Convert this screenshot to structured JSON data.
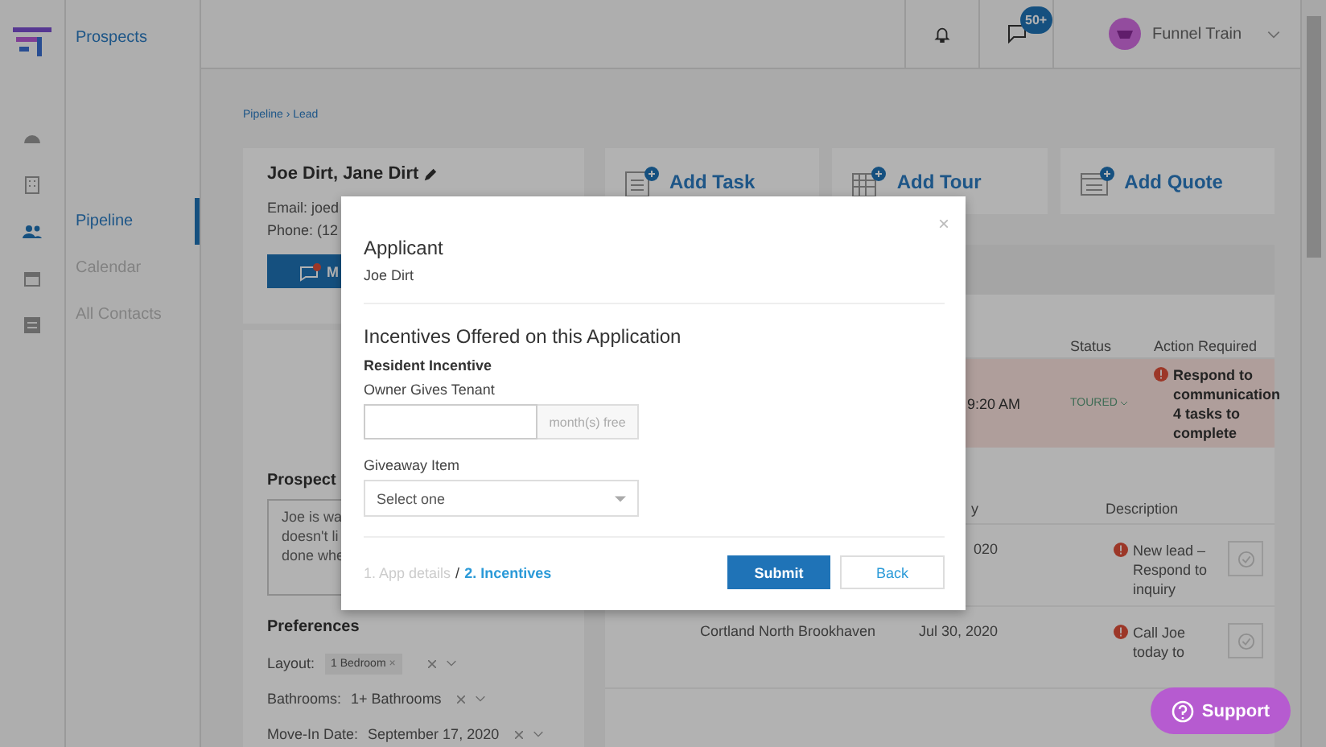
{
  "app": {
    "title": "Prospects"
  },
  "rail": [
    {
      "kind": "gauge",
      "selected": false
    },
    {
      "kind": "building",
      "selected": false
    },
    {
      "kind": "people",
      "selected": true
    },
    {
      "kind": "calendar",
      "selected": false
    },
    {
      "kind": "list",
      "selected": false
    }
  ],
  "nav": [
    {
      "label": "Pipeline",
      "selected": true
    },
    {
      "label": "Calendar",
      "selected": false
    },
    {
      "label": "All Contacts",
      "selected": false
    }
  ],
  "topbar": {
    "messages_badge": "50+",
    "user": "Funnel Train"
  },
  "breadcrumb": "Pipeline › Lead",
  "lead": {
    "name": "Joe Dirt, Jane Dirt",
    "email": "Email: joed",
    "phone": "Phone: (12",
    "message_button": "M",
    "notes_title": "Prospect",
    "notes_lines": [
      "Joe is wa",
      "doesn't li",
      "done whe"
    ]
  },
  "preferences": {
    "title": "Preferences",
    "items": [
      {
        "label": "Layout:",
        "value": "1 Bedroom",
        "kind": "tag",
        "remove": "×"
      },
      {
        "label": "Bathrooms:",
        "value": "1+ Bathrooms",
        "kind": "text"
      },
      {
        "label": "Move-In Date:",
        "value": "September 17, 2020",
        "kind": "text"
      }
    ]
  },
  "actions": [
    {
      "kind": "task",
      "label": "Add Task"
    },
    {
      "kind": "tour",
      "label": "Add Tour"
    },
    {
      "kind": "quote",
      "label": "Add Quote"
    }
  ],
  "tours": {
    "columns": [
      "Status",
      "Action Required"
    ],
    "row": {
      "time": "9:20 AM",
      "status": "TOURED",
      "action": "Respond to communication",
      "tasks": "4 tasks to complete"
    }
  },
  "tasks": {
    "columns": [
      "y",
      "Description"
    ],
    "rows": [
      {
        "date": "020",
        "description": "New lead – Respond to inquiry"
      },
      {
        "property": "Cortland North Brookhaven",
        "date": "Jul 30, 2020",
        "description": "Call Joe today to"
      }
    ]
  },
  "modal": {
    "close": "×",
    "title": "Applicant",
    "applicant": "Joe Dirt",
    "section": "Incentives Offered on this Application",
    "incentive_title": "Resident Incentive",
    "incentive_label": "Owner Gives Tenant",
    "incentive_addon": "month(s) free",
    "giveaway_label": "Giveaway Item",
    "giveaway_placeholder": "Select one",
    "steps": [
      {
        "label": "1. App details",
        "selected": false
      },
      {
        "label": "2. Incentives",
        "selected": true
      }
    ],
    "step_separator": "/",
    "submit": "Submit",
    "back": "Back"
  },
  "support": "Support"
}
